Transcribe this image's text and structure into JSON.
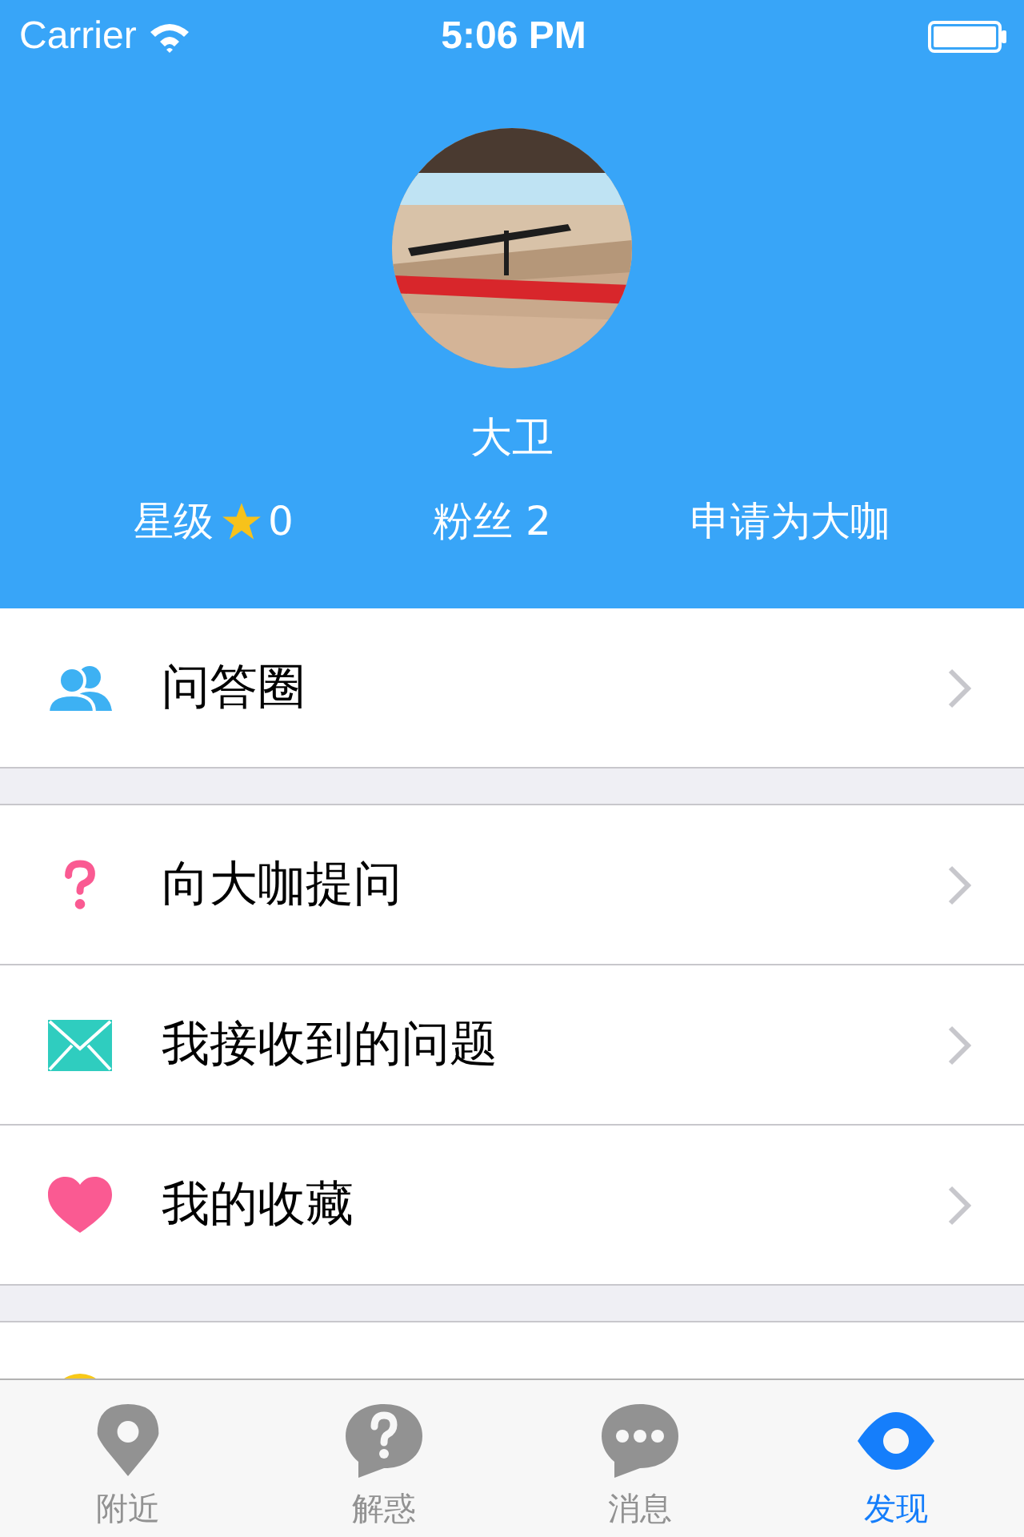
{
  "status_bar": {
    "carrier": "Carrier",
    "time": "5:06 PM"
  },
  "profile": {
    "name": "大卫",
    "stats": [
      {
        "kind": "stars",
        "label": "星级",
        "value": "0"
      },
      {
        "kind": "plain",
        "label": "粉丝",
        "value": "2"
      },
      {
        "kind": "link",
        "label": "申请为大咖"
      }
    ]
  },
  "menu_groups": [
    {
      "items": [
        {
          "kind": "people",
          "label": "问答圈"
        }
      ]
    },
    {
      "items": [
        {
          "kind": "question",
          "label": "向大咖提问"
        },
        {
          "kind": "mail",
          "label": "我接收到的问题"
        },
        {
          "kind": "heart",
          "label": "我的收藏"
        }
      ]
    },
    {
      "items": [
        {
          "kind": "sun"
        }
      ]
    }
  ],
  "tab_bar": [
    {
      "kind": "pin",
      "label": "附近",
      "selected": false
    },
    {
      "kind": "question",
      "label": "解惑",
      "selected": false
    },
    {
      "kind": "chat",
      "label": "消息",
      "selected": false
    },
    {
      "kind": "eye",
      "label": "发现",
      "selected": true
    }
  ]
}
